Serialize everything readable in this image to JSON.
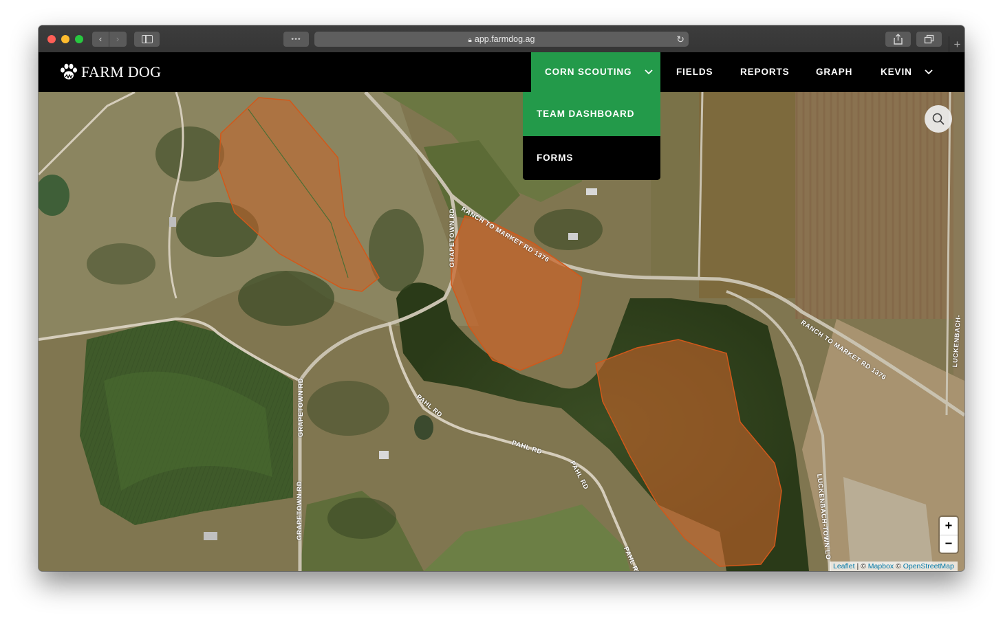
{
  "browser": {
    "url": "app.farmdog.ag",
    "dots": "•••"
  },
  "header": {
    "brand": "FARM DOG",
    "nav": {
      "corn_scouting": "CORN SCOUTING",
      "fields": "FIELDS",
      "reports": "REPORTS",
      "graph": "GRAPH",
      "user": "KEVIN"
    }
  },
  "dropdown": {
    "items": [
      "TEAM DASHBOARD",
      "FORMS"
    ]
  },
  "map": {
    "roads": {
      "grapetown_1": "GRAPETOWN RD",
      "rm1376_1": "RANCH TO MARKET RD 1376",
      "rm1376_2": "RANCH TO MARKET RD 1376",
      "grapetown_2": "GRAPETOWN RD",
      "grapetown_3": "GRAPETOWN RD",
      "pahl_1": "PAHL RD",
      "pahl_2": "PAHL RD",
      "pahl_3": "PAHL RD",
      "pahl_4": "PAHL RD",
      "luckenbach_1": "LUCKENBACH-TOWN LO",
      "luckenbach_2": "LUCKENBACH-"
    },
    "zoom_in": "+",
    "zoom_out": "−",
    "attribution": {
      "leaflet": "Leaflet",
      "sep": " | © ",
      "mapbox": "Mapbox",
      "copy": " © ",
      "osm": "OpenStreetMap"
    }
  },
  "colors": {
    "accent": "#239a4a",
    "field_fill": "#c8642a"
  }
}
